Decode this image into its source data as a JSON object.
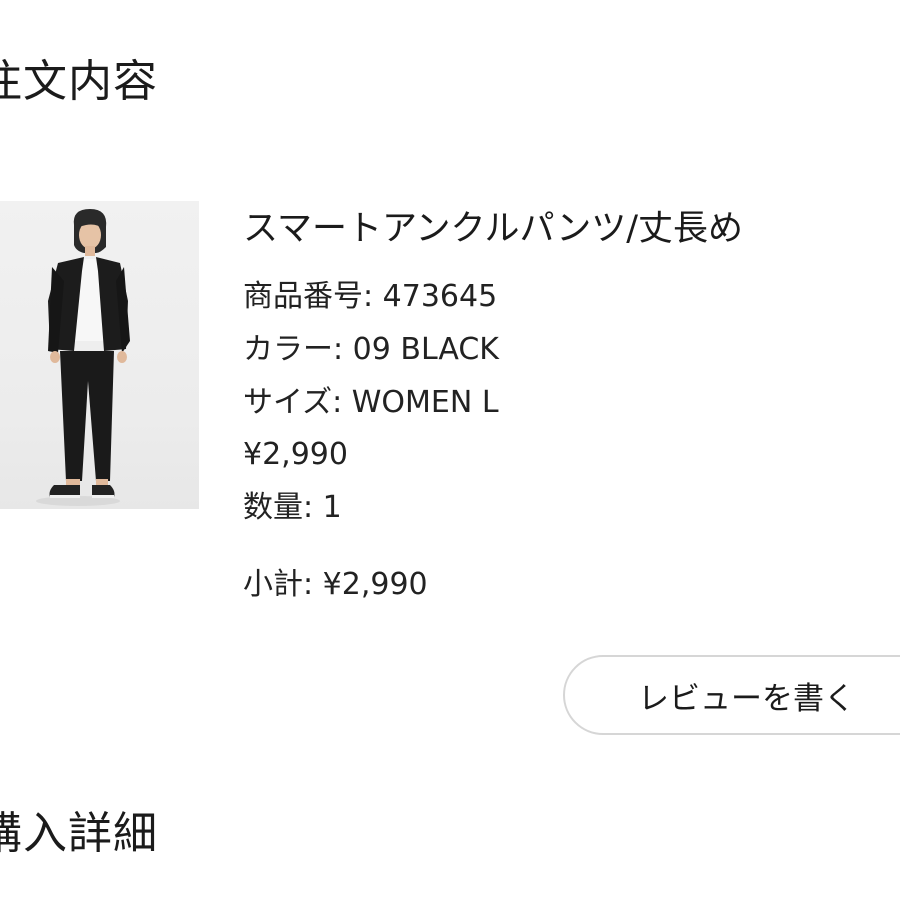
{
  "order_section": {
    "title": "注文内容"
  },
  "product": {
    "image_icon": "product-photo",
    "name": "スマートアンクルパンツ/丈長め",
    "number_label": "商品番号: ",
    "number_value": "473645",
    "color_label": "カラー: ",
    "color_value": "09 BLACK",
    "size_label": "サイズ: ",
    "size_value": "WOMEN L",
    "price": "¥2,990",
    "quantity_label": "数量: ",
    "quantity_value": "1",
    "subtotal_label": "小計: ",
    "subtotal_value": "¥2,990"
  },
  "review_button": {
    "label": "レビューを書く"
  },
  "purchase_section": {
    "title": "購入詳細"
  },
  "colors": {
    "text": "#1b1b1b",
    "button_border": "#d6d6d6",
    "background": "#ffffff"
  }
}
